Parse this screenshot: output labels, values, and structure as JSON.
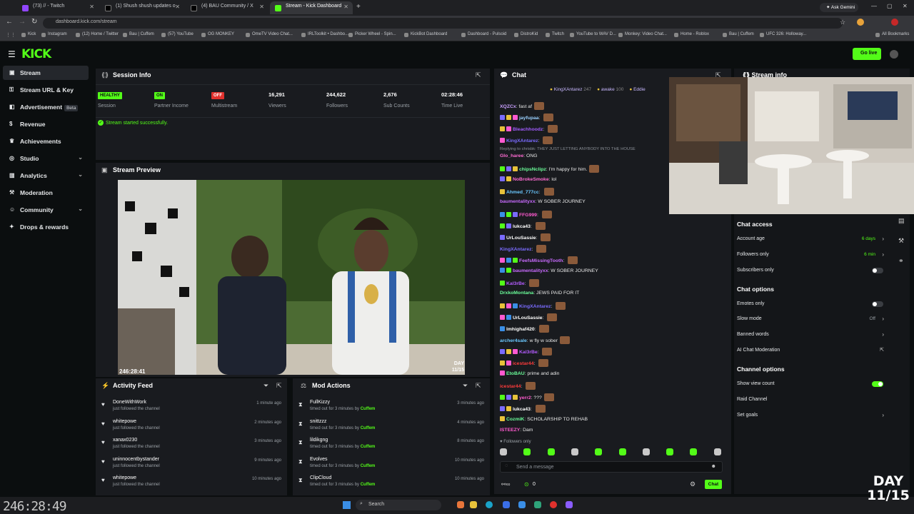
{
  "browser": {
    "tabs": [
      {
        "label": "(73) // - Twitch",
        "color": "#9146ff"
      },
      {
        "label": "(1) Shush shush updates o",
        "color": "#000000"
      },
      {
        "label": "(4) BAU Community / X",
        "color": "#000000"
      },
      {
        "label": "Stream - Kick Dashboard",
        "color": "#53fc18"
      }
    ],
    "url": "dashboard.kick.com/stream",
    "ask_gemini": "Ask Gemini",
    "bookmarks": [
      "Kick",
      "Instagram",
      "(12) Home / Twitter",
      "Bau | Cuffem",
      "(57) YouTube",
      "OG MONKEY",
      "OmeTV Video Chat...",
      "IRLToolkit • Dashbo...",
      "Picker Wheel - Spin...",
      "KickBot Dashboard",
      "Dashboard - Pulsoid",
      "DistroKid",
      "Twitch",
      "YouTube to WAV D...",
      "Monkey: Video Chat...",
      "Home - Roblox",
      "Bau | Cuffem",
      "UFC 326: Holloway..."
    ],
    "all_bookmarks": "All Bookmarks"
  },
  "header": {
    "logo": "KICK",
    "go_live": "Go live"
  },
  "sidebar": {
    "items": [
      {
        "label": "Stream",
        "icon": "broadcast-icon",
        "glyph": "▣"
      },
      {
        "label": "Stream URL & Key",
        "icon": "key-icon",
        "glyph": "⚿"
      },
      {
        "label": "Advertisement",
        "icon": "megaphone-icon",
        "glyph": "◧",
        "badge": "Beta"
      },
      {
        "label": "Revenue",
        "icon": "dollar-icon",
        "glyph": "$"
      },
      {
        "label": "Achievements",
        "icon": "trophy-icon",
        "glyph": "♛"
      },
      {
        "label": "Studio",
        "icon": "palette-icon",
        "glyph": "◎"
      },
      {
        "label": "Analytics",
        "icon": "chart-icon",
        "glyph": "▥"
      },
      {
        "label": "Moderation",
        "icon": "wrench-icon",
        "glyph": "⚒"
      },
      {
        "label": "Community",
        "icon": "people-icon",
        "glyph": "☺"
      },
      {
        "label": "Drops & rewards",
        "icon": "gift-icon",
        "glyph": "✦"
      }
    ]
  },
  "session": {
    "title": "Session Info",
    "stats": [
      {
        "badge": "HEALTHY",
        "badge_color": "#53fc18",
        "label": "Session"
      },
      {
        "badge": "ON",
        "badge_color": "#53fc18",
        "label": "Partner Income"
      },
      {
        "badge": "OFF",
        "badge_color": "#e0312d",
        "label": "Multistream"
      },
      {
        "value": "16,291",
        "label": "Viewers"
      },
      {
        "value": "244,622",
        "label": "Followers"
      },
      {
        "value": "2,676",
        "label": "Sub Counts"
      },
      {
        "value": "02:28:46",
        "label": "Time Live"
      }
    ],
    "status_message": "Stream started successfully."
  },
  "preview": {
    "title": "Stream Preview",
    "timer": "246:28:41",
    "day": "DAY",
    "day_count": "11/15"
  },
  "activity": {
    "title": "Activity Feed",
    "rows": [
      {
        "name": "DoneWithWork",
        "sub": "just followed the channel",
        "time": "1 minute ago"
      },
      {
        "name": "whitepowe",
        "sub": "just followed the channel",
        "time": "2 minutes ago"
      },
      {
        "name": "xanax0230",
        "sub": "just followed the channel",
        "time": "3 minutes ago"
      },
      {
        "name": "uninnocentbystander",
        "sub": "just followed the channel",
        "time": "9 minutes ago"
      },
      {
        "name": "whitepowe",
        "sub": "just followed the channel",
        "time": "10 minutes ago"
      }
    ]
  },
  "mod": {
    "title": "Mod Actions",
    "rows": [
      {
        "name": "FullKizzy",
        "sub": "timed out for 3 minutes by",
        "by": "Cuffem",
        "time": "3 minutes ago"
      },
      {
        "name": "snittzzz",
        "sub": "timed out for 3 minutes by",
        "by": "Cuffem",
        "time": "4 minutes ago"
      },
      {
        "name": "lildikgng",
        "sub": "timed out for 3 minutes by",
        "by": "Cuffem",
        "time": "8 minutes ago"
      },
      {
        "name": "Evolves",
        "sub": "timed out for 3 minutes by",
        "by": "Cuffem",
        "time": "10 minutes ago"
      },
      {
        "name": "ClipCloud",
        "sub": "timed out for 3 minutes by",
        "by": "Cuffem",
        "time": "10 minutes ago"
      }
    ]
  },
  "chat": {
    "title": "Chat",
    "pinned": [
      {
        "name": "KingXAntarez",
        "count": "247"
      },
      {
        "name": "awake",
        "count": "100"
      },
      {
        "name": "Eddie",
        "count": ""
      }
    ],
    "reply_note": "Replying to chrisbk: THEY JUST LETTING ANYBODY INTO THE HOUSE",
    "messages": [
      {
        "user": "XQZCx",
        "color": "#c9a0ff",
        "text": "fast af"
      },
      {
        "user": "jayfupaa",
        "color": "#9ad1ff",
        "text": ""
      },
      {
        "user": "Bleachhoodz",
        "color": "#a25cff",
        "text": ""
      },
      {
        "user": "KingXAntarez",
        "color": "#7a6bff",
        "text": ""
      },
      {
        "user": "Glo_haree",
        "color": "#ff6bd3",
        "text": "ONG"
      },
      {
        "user": "chipsNclipz",
        "color": "#6bff9a",
        "text": "I'm happy for him."
      },
      {
        "user": "NoBrokeSmoke",
        "color": "#ff6bd3",
        "text": "lol"
      },
      {
        "user": "Ahmed_777cc",
        "color": "#6bc8ff",
        "text": ""
      },
      {
        "user": "baumentalityxx",
        "color": "#c96bff",
        "text": "W SOBER JOURNEY"
      },
      {
        "user": "FFG999",
        "color": "#ff5ad0",
        "text": ""
      },
      {
        "user": "lukca43",
        "color": "#ffffff",
        "text": ""
      },
      {
        "user": "UrLouSassie",
        "color": "#ffffff",
        "text": ""
      },
      {
        "user": "KingXAntarez",
        "color": "#7a6bff",
        "text": ""
      },
      {
        "user": "FeefsMissingTooth",
        "color": "#c96bff",
        "text": ""
      },
      {
        "user": "baumentalityxx",
        "color": "#c96bff",
        "text": "W SOBER JOURNEY"
      },
      {
        "user": "Kal3rBe",
        "color": "#b45cff",
        "text": ""
      },
      {
        "user": "DrxkoMontana",
        "color": "#6bff9a",
        "text": "JEWS PAID FOR IT"
      },
      {
        "user": "KingXAntarez",
        "color": "#7a6bff",
        "text": ""
      },
      {
        "user": "UrLouSassie",
        "color": "#ffffff",
        "text": ""
      },
      {
        "user": "lmhighaf420",
        "color": "#ffffff",
        "text": ""
      },
      {
        "user": "archer4sale",
        "color": "#6bc8ff",
        "text": "w fly w sober"
      },
      {
        "user": "Kal3rBe",
        "color": "#b45cff",
        "text": ""
      },
      {
        "user": "icestar44",
        "color": "#ff3b3b",
        "text": ""
      },
      {
        "user": "EtoBAU",
        "color": "#6bff9a",
        "text": "prime and adin"
      },
      {
        "user": "icestar44",
        "color": "#ff3b3b",
        "text": ""
      },
      {
        "user": "yerr2",
        "color": "#ff5ad0",
        "text": "???"
      },
      {
        "user": "lukca43",
        "color": "#ffffff",
        "text": ""
      },
      {
        "user": "CozmiK",
        "color": "#6bff9a",
        "text": "SCHOLARSHIP TO REHAB"
      },
      {
        "user": "ISTEEZY",
        "color": "#ff5ad0",
        "text": "Dam"
      }
    ],
    "followers_only": "Followers only",
    "placeholder": "Send a message",
    "count": "0",
    "chat_button": "Chat"
  },
  "right": {
    "stream_info": "Stream info",
    "chat_access": "Chat access",
    "account_age": "Account age",
    "account_age_val": "6 days",
    "followers_only": "Followers only",
    "followers_only_val": "6 min",
    "subscribers_only": "Subscribers only",
    "chat_options": "Chat options",
    "emotes_only": "Emotes only",
    "slow_mode": "Slow mode",
    "slow_mode_val": "Off",
    "banned_words": "Banned words",
    "ai_mod": "AI Chat Moderation",
    "channel_options": "Channel options",
    "show_view_count": "Show view count",
    "raid_channel": "Raid Channel",
    "set_goals": "Set goals"
  },
  "overlay": {
    "timer": "246:28:49",
    "day": "DAY",
    "day_count": "11/15"
  },
  "taskbar": {
    "search": "Search"
  }
}
